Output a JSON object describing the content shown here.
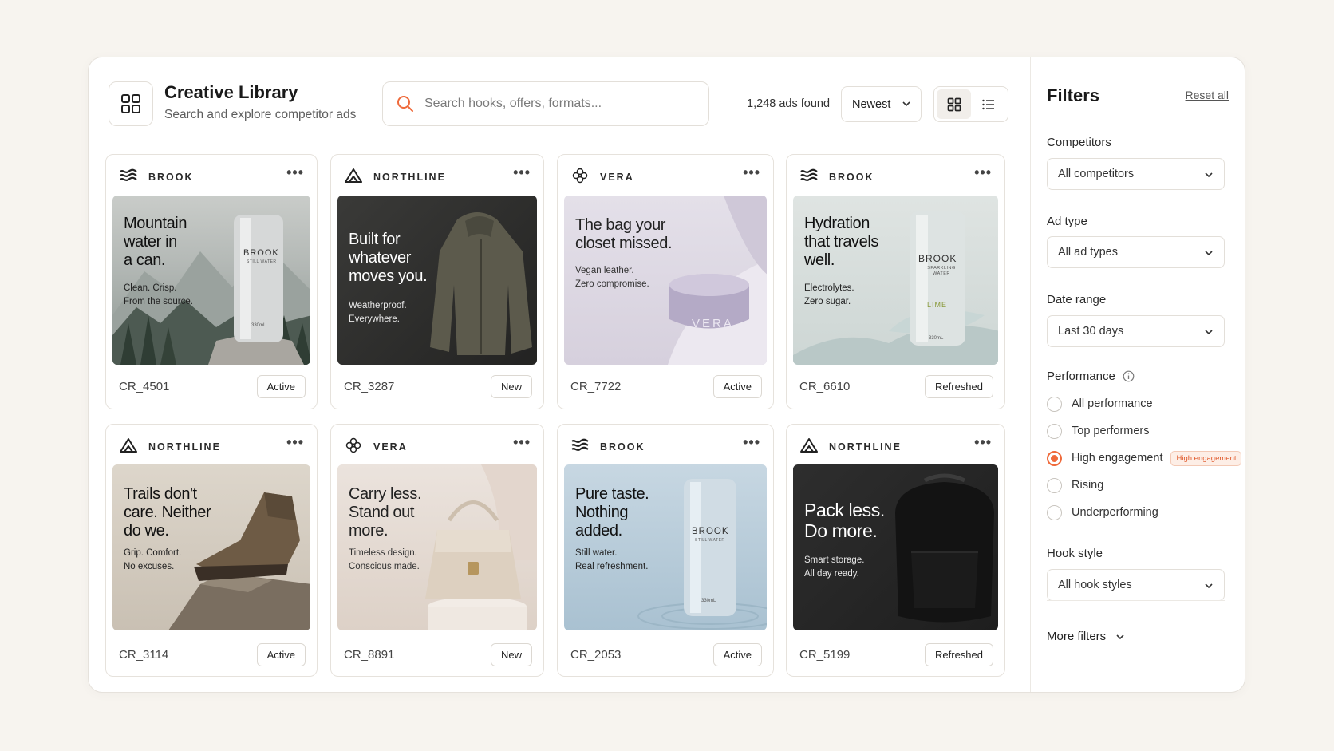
{
  "header": {
    "title": "Creative Library",
    "subtitle": "Search and explore competitor ads",
    "search_placeholder": "Search hooks, offers, formats...",
    "count": "1,248 ads found",
    "sort": "Newest",
    "view_mode": "grid"
  },
  "cards": [
    {
      "brand": "BROOK",
      "brand_icon": "waves-icon",
      "headline": [
        "Mountain",
        "water in",
        "a can."
      ],
      "sub": [
        "Clean. Crisp.",
        "From the source."
      ],
      "id": "CR_4501",
      "status": "Active"
    },
    {
      "brand": "NORTHLINE",
      "brand_icon": "mountain-icon",
      "headline": [
        "Built for",
        "whatever",
        "moves you."
      ],
      "sub": [
        "Weatherproof.",
        "Everywhere."
      ],
      "id": "CR_3287",
      "status": "New"
    },
    {
      "brand": "VERA",
      "brand_icon": "flower-icon",
      "headline": [
        "The bag your",
        "closet missed."
      ],
      "sub": [
        "Vegan leather.",
        "Zero compromise."
      ],
      "id": "CR_7722",
      "status": "Active",
      "product_text": "VERA"
    },
    {
      "brand": "BROOK",
      "brand_icon": "waves-icon",
      "headline": [
        "Hydration",
        "that travels",
        "well."
      ],
      "sub": [
        "Electrolytes.",
        "Zero sugar."
      ],
      "id": "CR_6610",
      "status": "Refreshed"
    },
    {
      "brand": "NORTHLINE",
      "brand_icon": "mountain-icon",
      "headline": [
        "Trails don't",
        "care. Neither",
        "do we."
      ],
      "sub": [
        "Grip. Comfort.",
        "No excuses."
      ],
      "id": "CR_3114",
      "status": "Active"
    },
    {
      "brand": "VERA",
      "brand_icon": "flower-icon",
      "headline": [
        "Carry less.",
        "Stand out",
        "more."
      ],
      "sub": [
        "Timeless design.",
        "Conscious made."
      ],
      "id": "CR_8891",
      "status": "New"
    },
    {
      "brand": "BROOK",
      "brand_icon": "waves-icon",
      "headline": [
        "Pure taste.",
        "Nothing",
        "added."
      ],
      "sub": [
        "Still water.",
        "Real refreshment."
      ],
      "id": "CR_2053",
      "status": "Active"
    },
    {
      "brand": "NORTHLINE",
      "brand_icon": "mountain-icon",
      "headline": [
        "Pack less.",
        "Do more."
      ],
      "sub": [
        "Smart storage.",
        "All day ready."
      ],
      "id": "CR_5199",
      "status": "Refreshed"
    }
  ],
  "can_labels": {
    "brook": "BROOK",
    "still": "STILL WATER",
    "sparkling": "SPARKLING WATER",
    "lime": "LIME",
    "volume": "330mL"
  },
  "filters": {
    "title": "Filters",
    "reset": "Reset all",
    "competitors_label": "Competitors",
    "competitors_value": "All competitors",
    "ad_type_label": "Ad type",
    "ad_type_value": "All ad types",
    "date_label": "Date range",
    "date_value": "Last 30 days",
    "performance_label": "Performance",
    "performance_options": [
      "All performance",
      "Top performers",
      "High engagement",
      "Rising",
      "Underperforming"
    ],
    "performance_selected": "High engagement",
    "performance_pill": "High engagement",
    "hook_label": "Hook style",
    "hook_value": "All hook styles",
    "more": "More filters"
  },
  "colors": {
    "accent": "#ef6a3b",
    "bg": "#f7f4ef"
  }
}
